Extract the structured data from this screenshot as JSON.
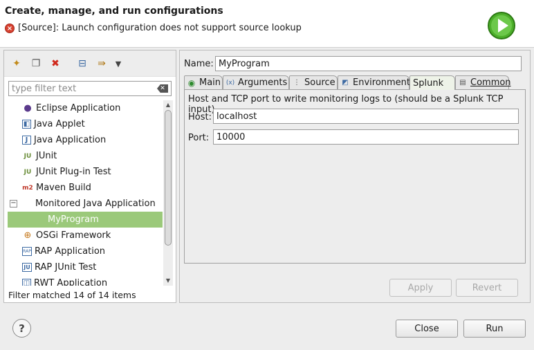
{
  "header": {
    "title": "Create, manage, and run configurations",
    "message": "[Source]: Launch configuration does not support source lookup",
    "error_icon": "error-icon",
    "run_icon": "run-icon"
  },
  "left": {
    "toolbar": [
      {
        "name": "new-configuration-icon",
        "glyph": "✦"
      },
      {
        "name": "duplicate-icon",
        "glyph": "❐"
      },
      {
        "name": "delete-icon",
        "glyph": "✖"
      },
      {
        "name": "collapse-all-icon",
        "glyph": "⊟"
      },
      {
        "name": "filter-icon",
        "glyph": "⇛"
      },
      {
        "name": "view-menu-icon",
        "glyph": "▾"
      }
    ],
    "filter_placeholder": "type filter text",
    "tree": [
      {
        "label": "Eclipse Application",
        "icon": "eclipse-icon",
        "color": "#5b3a8c"
      },
      {
        "label": "Java Applet",
        "icon": "java-applet-icon",
        "color": "#3d6aa3"
      },
      {
        "label": "Java Application",
        "icon": "java-application-icon",
        "color": "#3d6aa3"
      },
      {
        "label": "JUnit",
        "icon": "junit-icon",
        "color": "#6b8e3a"
      },
      {
        "label": "JUnit Plug-in Test",
        "icon": "junit-plugin-icon",
        "color": "#6b8e3a"
      },
      {
        "label": "Maven Build",
        "icon": "maven-icon",
        "color": "#c0392b"
      },
      {
        "label": "Monitored Java Application",
        "icon": "",
        "color": "#000000",
        "expander": "−"
      },
      {
        "label": "MyProgram",
        "icon": "",
        "color": "#ffffff",
        "selected": true,
        "child": true
      },
      {
        "label": "OSGi Framework",
        "icon": "osgi-icon",
        "color": "#c67a1e"
      },
      {
        "label": "RAP Application",
        "icon": "rap-icon",
        "color": "#3d6aa3"
      },
      {
        "label": "RAP JUnit Test",
        "icon": "rap-junit-icon",
        "color": "#3d6aa3"
      },
      {
        "label": "RWT Application",
        "icon": "rwt-icon",
        "color": "#3d6aa3"
      }
    ],
    "status": "Filter matched 14 of 14 items"
  },
  "right": {
    "name_label": "Name:",
    "name_value": "MyProgram",
    "tabs": [
      {
        "label": "Main",
        "icon": "main-tab-icon"
      },
      {
        "label": "Arguments",
        "icon": "arguments-tab-icon"
      },
      {
        "label": "Source",
        "icon": "source-tab-icon"
      },
      {
        "label": "Environment",
        "icon": "environment-tab-icon"
      },
      {
        "label": "Splunk",
        "icon": "",
        "active": true
      },
      {
        "label": "Common",
        "icon": "common-tab-icon"
      }
    ],
    "description": "Host and TCP port to write monitoring logs to (should be a Splunk TCP input).",
    "host_label": "Host:",
    "host_value": "localhost",
    "port_label": "Port:",
    "port_value": "10000",
    "apply_label": "Apply",
    "revert_label": "Revert"
  },
  "footer": {
    "help_label": "?",
    "close_label": "Close",
    "run_label": "Run"
  }
}
